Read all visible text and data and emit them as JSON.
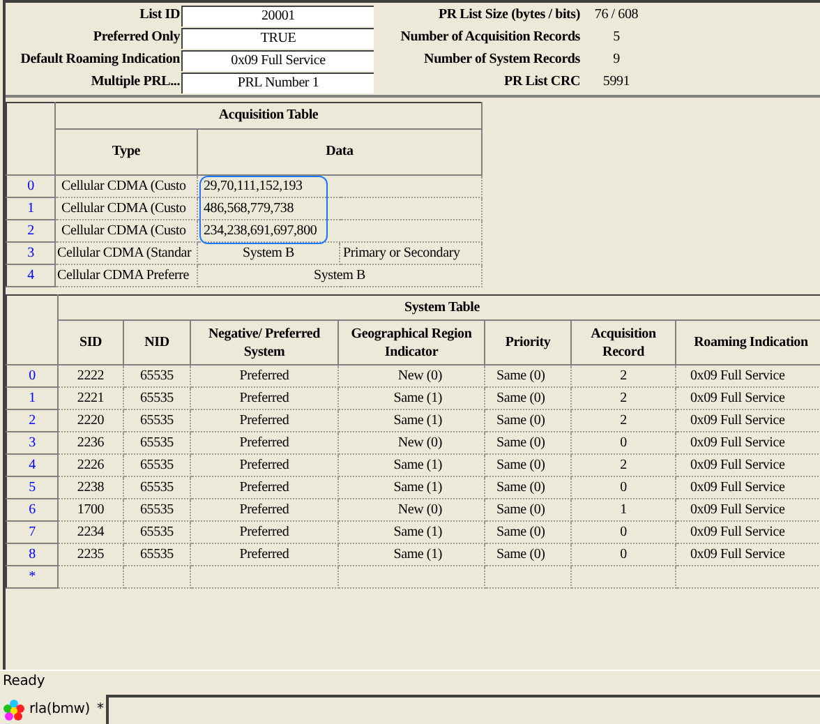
{
  "form": {
    "left": [
      {
        "label": "List ID",
        "value": "20001"
      },
      {
        "label": "Preferred Only",
        "value": "TRUE"
      },
      {
        "label": "Default Roaming Indication",
        "value": "0x09  Full Service"
      },
      {
        "label": "Multiple PRL...",
        "value": "PRL Number 1"
      }
    ],
    "right": [
      {
        "label": "PR List Size (bytes / bits)",
        "value": "76 / 608"
      },
      {
        "label": "Number of Acquisition Records",
        "value": "5"
      },
      {
        "label": "Number of System Records",
        "value": "9"
      },
      {
        "label": "PR List CRC",
        "value": "5991"
      }
    ]
  },
  "acquisition_table": {
    "title": "Acquisition Table",
    "columns": [
      "Type",
      "Data"
    ],
    "rows": [
      {
        "index": "0",
        "type": "Cellular CDMA (Custo",
        "kind": "list",
        "circled": true,
        "data": [
          "29,70,111,152,193"
        ]
      },
      {
        "index": "1",
        "type": "Cellular CDMA (Custo",
        "kind": "list",
        "circled": true,
        "data": [
          "486,568,779,738"
        ]
      },
      {
        "index": "2",
        "type": "Cellular CDMA (Custo",
        "kind": "list",
        "circled": true,
        "data": [
          "234,238,691,697,800"
        ]
      },
      {
        "index": "3",
        "type": "Cellular CDMA (Standar",
        "kind": "pair",
        "circled": false,
        "data": [
          "System B",
          "Primary or Secondary"
        ]
      },
      {
        "index": "4",
        "type": "Cellular CDMA Preferre",
        "kind": "single",
        "circled": false,
        "data": [
          "System B"
        ]
      }
    ]
  },
  "system_table": {
    "title": "System Table",
    "columns": [
      "SID",
      "NID",
      "Negative/ Preferred System",
      "Geographical Region Indicator",
      "Priority",
      "Acquisition Record",
      "Roaming Indication"
    ],
    "rows": [
      {
        "index": "0",
        "cells": [
          "2222",
          "65535",
          "Preferred",
          "New (0)",
          "Same (0)",
          "2",
          "0x09  Full Service"
        ]
      },
      {
        "index": "1",
        "cells": [
          "2221",
          "65535",
          "Preferred",
          "Same (1)",
          "Same (0)",
          "2",
          "0x09  Full Service"
        ]
      },
      {
        "index": "2",
        "cells": [
          "2220",
          "65535",
          "Preferred",
          "Same (1)",
          "Same (0)",
          "2",
          "0x09  Full Service"
        ]
      },
      {
        "index": "3",
        "cells": [
          "2236",
          "65535",
          "Preferred",
          "New (0)",
          "Same (0)",
          "0",
          "0x09  Full Service"
        ]
      },
      {
        "index": "4",
        "cells": [
          "2226",
          "65535",
          "Preferred",
          "Same (1)",
          "Same (0)",
          "2",
          "0x09  Full Service"
        ]
      },
      {
        "index": "5",
        "cells": [
          "2238",
          "65535",
          "Preferred",
          "Same (1)",
          "Same (0)",
          "0",
          "0x09  Full Service"
        ]
      },
      {
        "index": "6",
        "cells": [
          "1700",
          "65535",
          "Preferred",
          "New (0)",
          "Same (0)",
          "1",
          "0x09  Full Service"
        ]
      },
      {
        "index": "7",
        "cells": [
          "2234",
          "65535",
          "Preferred",
          "Same (1)",
          "Same (0)",
          "0",
          "0x09  Full Service"
        ]
      },
      {
        "index": "8",
        "cells": [
          "2235",
          "65535",
          "Preferred",
          "Same (1)",
          "Same (0)",
          "0",
          "0x09  Full Service"
        ]
      }
    ],
    "new_row_marker": "*"
  },
  "status_bar": "Ready",
  "tab": {
    "label": "rla(bmw)",
    "modified_mark": "*"
  }
}
